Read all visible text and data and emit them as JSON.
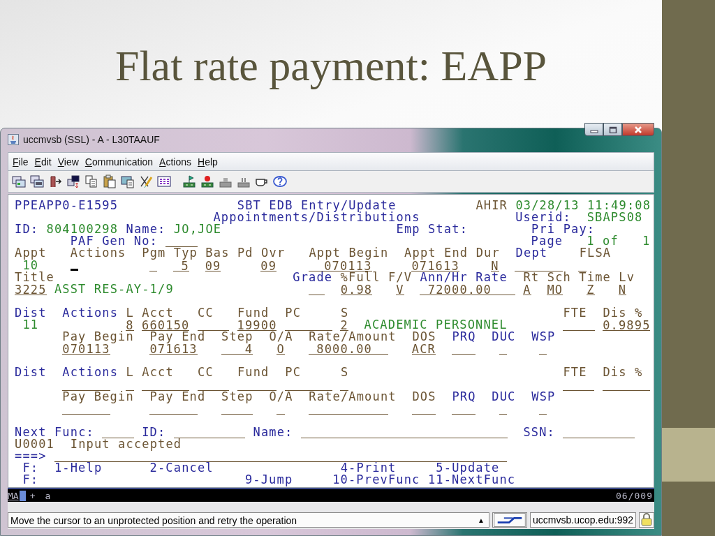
{
  "slide": {
    "title": "Flat rate payment: EAPP"
  },
  "window": {
    "title": "uccmvsb (SSL) - A - L30TAAUF"
  },
  "menu": [
    "File",
    "Edit",
    "View",
    "Communication",
    "Actions",
    "Help"
  ],
  "terminal": {
    "lines": [
      [
        {
          "kind": "text",
          "text": "PPEAPP0-E1595",
          "color": "#2a2a9c"
        },
        {
          "kind": "text",
          "text": "SBT EDB Entry/Update",
          "color": "#2a2a9c"
        },
        {
          "kind": "text",
          "text": "AHIR",
          "color": "#6b5433"
        },
        {
          "kind": "text",
          "text": "03/28/13",
          "color": "#2e8b2e"
        },
        {
          "kind": "text",
          "text": "11:49:08",
          "color": "#2e8b2e"
        }
      ],
      [
        {
          "kind": "text",
          "text": "Appointments/Distributions",
          "color": "#2a2a9c"
        },
        {
          "kind": "text",
          "text": "Userid:",
          "color": "#2a2a9c"
        },
        {
          "kind": "text",
          "text": "SBAPS08",
          "color": "#2e8b2e"
        }
      ],
      [
        {
          "kind": "text",
          "text": "ID:",
          "color": "#2a2a9c"
        },
        {
          "kind": "text",
          "text": "804100298",
          "color": "#2e8b2e"
        },
        {
          "kind": "text",
          "text": "Name:",
          "color": "#2a2a9c"
        },
        {
          "kind": "text",
          "text": "JO,JOE",
          "color": "#2e8b2e"
        },
        {
          "kind": "text",
          "text": "Emp Stat:",
          "color": "#2a2a9c"
        },
        {
          "kind": "text",
          "text": "Pri Pay:",
          "color": "#2a2a9c"
        }
      ],
      [
        {
          "kind": "text",
          "text": "PAF Gen No:",
          "color": "#2a2a9c"
        },
        {
          "kind": "field"
        },
        {
          "kind": "text",
          "text": "Page",
          "color": "#2a2a9c"
        },
        {
          "kind": "text",
          "text": "1",
          "color": "#2e8b2e"
        },
        {
          "kind": "text",
          "text": "of",
          "color": "#2e8b2e"
        },
        {
          "kind": "text",
          "text": "1",
          "color": "#2e8b2e"
        }
      ],
      [
        {
          "kind": "text",
          "text": "Appt",
          "color": "#6b5433"
        },
        {
          "kind": "text",
          "text": "Actions",
          "color": "#6b5433"
        },
        {
          "kind": "text",
          "text": "Pgm",
          "color": "#6b5433"
        },
        {
          "kind": "text",
          "text": "Typ",
          "color": "#6b5433"
        },
        {
          "kind": "text",
          "text": "Bas",
          "color": "#6b5433"
        },
        {
          "kind": "text",
          "text": "Pd",
          "color": "#6b5433"
        },
        {
          "kind": "text",
          "text": "Ovr",
          "color": "#6b5433"
        },
        {
          "kind": "text",
          "text": "Appt Begin",
          "color": "#6b5433"
        },
        {
          "kind": "text",
          "text": "Appt End",
          "color": "#6b5433"
        },
        {
          "kind": "text",
          "text": "Dur",
          "color": "#6b5433"
        },
        {
          "kind": "text",
          "text": "Dept",
          "color": "#2a2a9c"
        },
        {
          "kind": "text",
          "text": "FLSA",
          "color": "#6b5433"
        }
      ],
      [
        {
          "kind": "text",
          "text": "10",
          "color": "#2e8b2e"
        },
        {
          "kind": "cursor"
        },
        {
          "kind": "field"
        },
        {
          "kind": "field",
          "value": "5"
        },
        {
          "kind": "field",
          "value": "09"
        },
        {
          "kind": "field",
          "value": "09"
        },
        {
          "kind": "field",
          "value": "070113"
        },
        {
          "kind": "field",
          "value": "071613"
        },
        {
          "kind": "field",
          "value": "N"
        },
        {
          "kind": "field"
        },
        {
          "kind": "field"
        }
      ],
      [
        {
          "kind": "text",
          "text": "Title",
          "color": "#6b5433"
        },
        {
          "kind": "text",
          "text": "Grade",
          "color": "#2a2a9c"
        },
        {
          "kind": "text",
          "text": "%Full",
          "color": "#6b5433"
        },
        {
          "kind": "text",
          "text": "F/V",
          "color": "#6b5433"
        },
        {
          "kind": "text",
          "text": "Ann/Hr Rate",
          "color": "#2a2a9c"
        },
        {
          "kind": "text",
          "text": "Rt",
          "color": "#6b5433"
        },
        {
          "kind": "text",
          "text": "Sch",
          "color": "#6b5433"
        },
        {
          "kind": "text",
          "text": "Time",
          "color": "#6b5433"
        },
        {
          "kind": "text",
          "text": "Lv",
          "color": "#6b5433"
        }
      ],
      [
        {
          "kind": "field",
          "value": "3225"
        },
        {
          "kind": "text",
          "text": "ASST RES-AY-1/9",
          "color": "#2e8b2e"
        },
        {
          "kind": "field"
        },
        {
          "kind": "field",
          "value": "0.98"
        },
        {
          "kind": "field",
          "value": "V"
        },
        {
          "kind": "field",
          "value": "72000.00"
        },
        {
          "kind": "field",
          "value": "A"
        },
        {
          "kind": "field",
          "value": "MO"
        },
        {
          "kind": "field",
          "value": "Z"
        },
        {
          "kind": "field",
          "value": "N"
        }
      ],
      [
        {
          "kind": "text",
          "text": "Dist",
          "color": "#2a2a9c"
        },
        {
          "kind": "text",
          "text": "Actions",
          "color": "#2a2a9c"
        },
        {
          "kind": "text",
          "text": "L",
          "color": "#6b5433"
        },
        {
          "kind": "text",
          "text": "Acct",
          "color": "#6b5433"
        },
        {
          "kind": "text",
          "text": "CC",
          "color": "#6b5433"
        },
        {
          "kind": "text",
          "text": "Fund",
          "color": "#6b5433"
        },
        {
          "kind": "text",
          "text": "PC",
          "color": "#6b5433"
        },
        {
          "kind": "text",
          "text": "S",
          "color": "#6b5433"
        },
        {
          "kind": "text",
          "text": "FTE",
          "color": "#6b5433"
        },
        {
          "kind": "text",
          "text": "Dis %",
          "color": "#6b5433"
        }
      ],
      [
        {
          "kind": "text",
          "text": "11",
          "color": "#2e8b2e"
        },
        {
          "kind": "field",
          "value": "8"
        },
        {
          "kind": "field",
          "value": "660150"
        },
        {
          "kind": "field"
        },
        {
          "kind": "field",
          "value": "19900"
        },
        {
          "kind": "field"
        },
        {
          "kind": "field",
          "value": "2"
        },
        {
          "kind": "text",
          "text": "ACADEMIC PERSONNEL",
          "color": "#2e8b2e"
        },
        {
          "kind": "field"
        },
        {
          "kind": "field",
          "value": "0.9895"
        }
      ],
      [
        {
          "kind": "text",
          "text": "Pay Begin",
          "color": "#6b5433"
        },
        {
          "kind": "text",
          "text": "Pay End",
          "color": "#6b5433"
        },
        {
          "kind": "text",
          "text": "Step",
          "color": "#6b5433"
        },
        {
          "kind": "text",
          "text": "O/A",
          "color": "#6b5433"
        },
        {
          "kind": "text",
          "text": "Rate/Amount",
          "color": "#6b5433"
        },
        {
          "kind": "text",
          "text": "DOS",
          "color": "#6b5433"
        },
        {
          "kind": "text",
          "text": "PRQ",
          "color": "#2a2a9c"
        },
        {
          "kind": "text",
          "text": "DUC",
          "color": "#2a2a9c"
        },
        {
          "kind": "text",
          "text": "WSP",
          "color": "#2a2a9c"
        }
      ],
      [
        {
          "kind": "field",
          "value": "070113"
        },
        {
          "kind": "field",
          "value": "071613"
        },
        {
          "kind": "field",
          "value": "4"
        },
        {
          "kind": "field",
          "value": "O"
        },
        {
          "kind": "field",
          "value": "8000.00"
        },
        {
          "kind": "field",
          "value": "ACR"
        },
        {
          "kind": "field"
        },
        {
          "kind": "field"
        },
        {
          "kind": "field"
        }
      ],
      [
        {
          "kind": "text",
          "text": "Dist",
          "color": "#2a2a9c"
        },
        {
          "kind": "text",
          "text": "Actions",
          "color": "#2a2a9c"
        },
        {
          "kind": "text",
          "text": "L",
          "color": "#6b5433"
        },
        {
          "kind": "text",
          "text": "Acct",
          "color": "#6b5433"
        },
        {
          "kind": "text",
          "text": "CC",
          "color": "#6b5433"
        },
        {
          "kind": "text",
          "text": "Fund",
          "color": "#6b5433"
        },
        {
          "kind": "text",
          "text": "PC",
          "color": "#6b5433"
        },
        {
          "kind": "text",
          "text": "S",
          "color": "#6b5433"
        },
        {
          "kind": "text",
          "text": "FTE",
          "color": "#6b5433"
        },
        {
          "kind": "text",
          "text": "Dis %",
          "color": "#6b5433"
        }
      ],
      [
        {
          "kind": "field"
        },
        {
          "kind": "field"
        },
        {
          "kind": "field"
        },
        {
          "kind": "field"
        },
        {
          "kind": "field"
        },
        {
          "kind": "field"
        },
        {
          "kind": "field"
        },
        {
          "kind": "field"
        },
        {
          "kind": "field"
        }
      ],
      [
        {
          "kind": "text",
          "text": "Pay Begin",
          "color": "#6b5433"
        },
        {
          "kind": "text",
          "text": "Pay End",
          "color": "#6b5433"
        },
        {
          "kind": "text",
          "text": "Step",
          "color": "#6b5433"
        },
        {
          "kind": "text",
          "text": "O/A",
          "color": "#6b5433"
        },
        {
          "kind": "text",
          "text": "Rate/Amount",
          "color": "#6b5433"
        },
        {
          "kind": "text",
          "text": "DOS",
          "color": "#6b5433"
        },
        {
          "kind": "text",
          "text": "PRQ",
          "color": "#2a2a9c"
        },
        {
          "kind": "text",
          "text": "DUC",
          "color": "#2a2a9c"
        },
        {
          "kind": "text",
          "text": "WSP",
          "color": "#2a2a9c"
        }
      ],
      [
        {
          "kind": "field"
        },
        {
          "kind": "field"
        },
        {
          "kind": "field"
        },
        {
          "kind": "field"
        },
        {
          "kind": "field"
        },
        {
          "kind": "field"
        },
        {
          "kind": "field"
        },
        {
          "kind": "field"
        },
        {
          "kind": "field"
        }
      ],
      [
        {
          "kind": "text",
          "text": "Next Func:",
          "color": "#2a2a9c"
        },
        {
          "kind": "field"
        },
        {
          "kind": "text",
          "text": "ID:",
          "color": "#2a2a9c"
        },
        {
          "kind": "field"
        },
        {
          "kind": "text",
          "text": "Name:",
          "color": "#2a2a9c"
        },
        {
          "kind": "field"
        },
        {
          "kind": "text",
          "text": "SSN:",
          "color": "#2a2a9c"
        },
        {
          "kind": "field"
        }
      ],
      [
        {
          "kind": "text",
          "text": "U0001",
          "color": "#6b5433"
        },
        {
          "kind": "text",
          "text": "Input accepted",
          "color": "#6b5433"
        }
      ],
      [
        {
          "kind": "text",
          "text": "===>",
          "color": "#2a2a9c"
        },
        {
          "kind": "field"
        }
      ],
      [
        {
          "kind": "text",
          "text": "F:",
          "color": "#2a2a9c"
        },
        {
          "kind": "text",
          "text": "1-Help",
          "color": "#2a2a9c"
        },
        {
          "kind": "text",
          "text": "2-Cancel",
          "color": "#2a2a9c"
        },
        {
          "kind": "text",
          "text": "4-Print",
          "color": "#2a2a9c"
        },
        {
          "kind": "text",
          "text": "5-Update",
          "color": "#2a2a9c"
        }
      ],
      [
        {
          "kind": "text",
          "text": "F:",
          "color": "#2a2a9c"
        },
        {
          "kind": "text",
          "text": "9-Jump",
          "color": "#2a2a9c"
        },
        {
          "kind": "text",
          "text": "10-PrevFunc",
          "color": "#2a2a9c"
        },
        {
          "kind": "text",
          "text": "11-NextFunc",
          "color": "#2a2a9c"
        }
      ]
    ]
  },
  "oia": {
    "mode": "MA",
    "indicators": [
      "+",
      "a"
    ],
    "cursor_position": "06/009"
  },
  "status_bar": {
    "message": "Move the cursor to an unprotected position and retry the operation",
    "scroll_arrow": "▲",
    "host": "uccmvsb.ucop.edu:992"
  }
}
